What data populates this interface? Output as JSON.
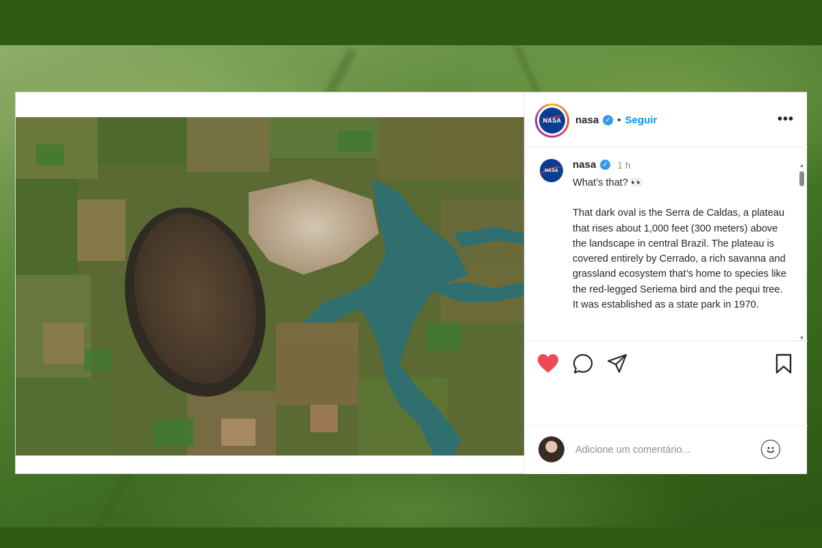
{
  "post": {
    "header": {
      "username": "nasa",
      "verified_icon": "verified-badge-icon",
      "separator": "•",
      "follow_label": "Seguir",
      "more_label": "•••"
    },
    "caption": {
      "username": "nasa",
      "time": "1 h",
      "intro": "What’s that? 👀",
      "body": "That dark oval is the Serra de Caldas, a plateau that rises about 1,000 feet (300 meters) above the landscape in central Brazil. The plateau is covered entirely by Cerrado, a rich savanna and grassland ecosystem that’s home to species like the red-legged Seriema bird and the pequi tree. It was established as a state park in 1970."
    },
    "logo_text": "NASA",
    "actions": {
      "like_icon": "heart-icon",
      "like_color": "#ed4956",
      "comment_icon": "comment-icon",
      "share_icon": "share-icon",
      "save_icon": "bookmark-icon"
    },
    "comment": {
      "placeholder": "Adicione um comentário...",
      "emoji_icon": "emoji-icon"
    },
    "colors": {
      "accent": "#0095f6",
      "verified": "#3897f0",
      "background": "#2e5a14"
    }
  }
}
